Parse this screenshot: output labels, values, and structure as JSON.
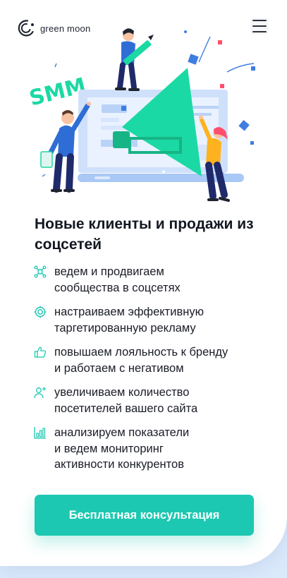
{
  "header": {
    "logo_text": "green moon",
    "menu_icon": "hamburger-menu-icon"
  },
  "hero": {
    "badge_text": "SMM",
    "colors": {
      "accent": "#1bd9a4",
      "blue": "#3f7de0",
      "light_blue": "#cfe0fb"
    }
  },
  "main": {
    "title": "Новые клиенты и продажи из соцсетей",
    "features": [
      {
        "icon": "network-icon",
        "text": "ведем и продвигаем\nсообщества в соцсетях"
      },
      {
        "icon": "target-icon",
        "text": "настраиваем эффективную\nтаргетированную рекламу"
      },
      {
        "icon": "thumbs-up-icon",
        "text": "повышаем лояльность к бренду\nи работаем с негативом"
      },
      {
        "icon": "add-user-icon",
        "text": "увеличиваем количество\nпосетителей вашего сайта"
      },
      {
        "icon": "bar-chart-icon",
        "text": "анализируем показатели\nи ведем мониторинг\nактивности конкурентов"
      }
    ],
    "cta_label": "Бесплатная консультация"
  },
  "colors": {
    "accent": "#1cc8b1",
    "text": "#131722",
    "background": "#dbe9fb"
  }
}
